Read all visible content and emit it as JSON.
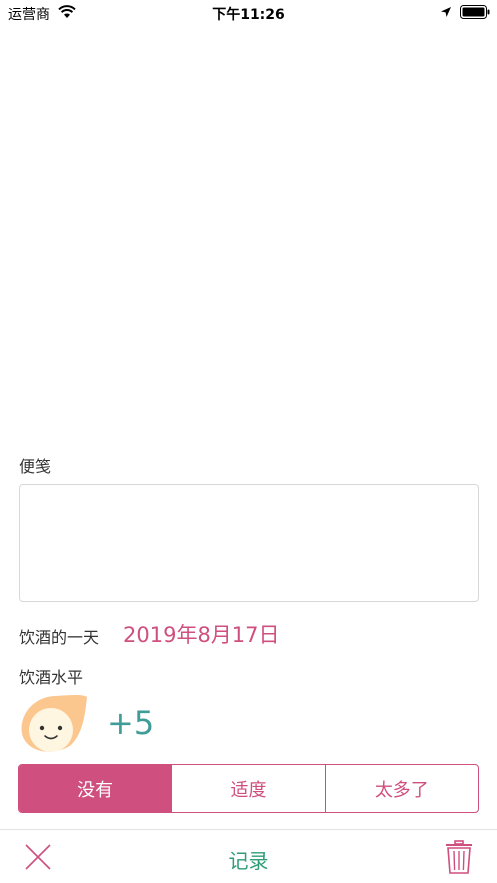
{
  "status_bar": {
    "carrier": "运营商",
    "time": "下午11:26"
  },
  "form": {
    "memo_label": "便笺",
    "memo_value": "",
    "drink_day_label": "饮酒的一天",
    "drink_date": "2019年8月17日",
    "drink_level_label": "饮酒水平",
    "level_value": "+5",
    "level_options": [
      {
        "label": "没有",
        "selected": true
      },
      {
        "label": "适度",
        "selected": false
      },
      {
        "label": "太多了",
        "selected": false
      }
    ]
  },
  "bottom_bar": {
    "record_label": "记录"
  },
  "colors": {
    "accent_pink": "#cf4f7e",
    "teal": "#3f9c96",
    "green": "#2e9c78",
    "face_orange": "#fbc78e",
    "face_cream": "#fff6e2"
  },
  "icons": [
    "wifi-icon",
    "location-icon",
    "battery-icon",
    "smiley-face-icon",
    "close-icon",
    "trash-icon"
  ]
}
